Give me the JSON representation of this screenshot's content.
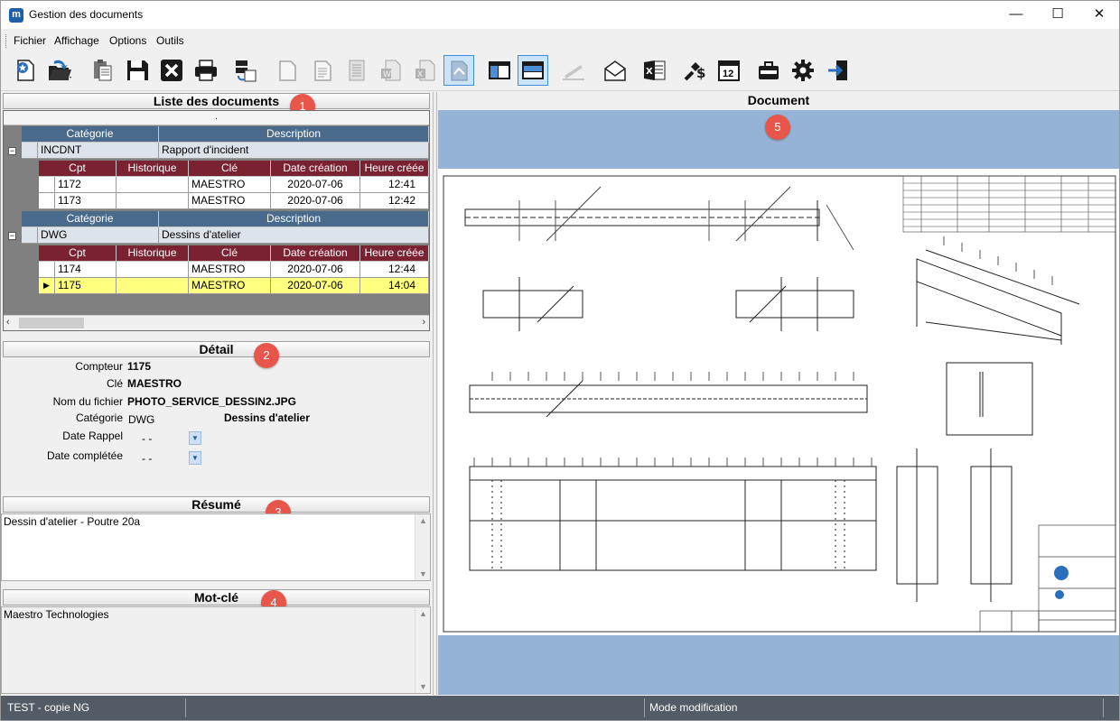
{
  "window": {
    "title": "Gestion des documents",
    "app_icon_letter": "m",
    "controls": {
      "minimize": "—",
      "maximize": "☐",
      "close": "✕"
    }
  },
  "menu": [
    "Fichier",
    "Affichage",
    "Options",
    "Outils"
  ],
  "toolbar": {
    "icons": [
      "new-document-icon",
      "open-folder-icon",
      "paste-icon",
      "save-icon",
      "cancel-icon",
      "print-icon",
      "scan-icon",
      "blank-page-icon",
      "text-page-icon",
      "lined-page-icon",
      "word-doc-icon",
      "excel-doc-icon",
      "image-tool-icon",
      "layout-view-icon",
      "layout-view-alt-icon",
      "pen-icon",
      "email-icon",
      "excel-export-icon",
      "price-icon",
      "calendar-icon",
      "briefcase-icon",
      "settings-icon",
      "exit-icon"
    ],
    "calendar_day": "12"
  },
  "list_panel": {
    "title": "Liste des documents",
    "badge": "1",
    "top_strip": ".",
    "group_headers": {
      "category": "Catégorie",
      "description": "Description"
    },
    "columns": [
      "Cpt",
      "Historique",
      "Clé",
      "Date création",
      "Heure créée"
    ],
    "groups": [
      {
        "category": "INCDNT",
        "description": "Rapport d'incident",
        "rows": [
          {
            "cpt": "1172",
            "historique": "",
            "cle": "MAESTRO",
            "date": "2020-07-06",
            "heure": "12:41"
          },
          {
            "cpt": "1173",
            "historique": "",
            "cle": "MAESTRO",
            "date": "2020-07-06",
            "heure": "12:42"
          }
        ]
      },
      {
        "category": "DWG",
        "description": "Dessins d'atelier",
        "rows": [
          {
            "cpt": "1174",
            "historique": "",
            "cle": "MAESTRO",
            "date": "2020-07-06",
            "heure": "12:44"
          },
          {
            "cpt": "1175",
            "historique": "",
            "cle": "MAESTRO",
            "date": "2020-07-06",
            "heure": "14:04"
          }
        ]
      }
    ]
  },
  "detail_panel": {
    "title": "Détail",
    "badge": "2",
    "compteur_label": "Compteur",
    "compteur": "1175",
    "cle_label": "Clé",
    "cle": "MAESTRO",
    "fichier_label": "Nom du fichier",
    "fichier": "PHOTO_SERVICE_DESSIN2.JPG",
    "categorie_label": "Catégorie",
    "categorie_code": "DWG",
    "categorie_desc": "Dessins d'atelier",
    "date_rappel_label": "Date Rappel",
    "date_rappel": "- -",
    "date_completee_label": "Date complétée",
    "date_completee": "- -"
  },
  "resume_panel": {
    "title": "Résumé",
    "badge": "3",
    "text": "Dessin d'atelier - Poutre 20a"
  },
  "motcle_panel": {
    "title": "Mot-clé",
    "badge": "4",
    "text": "Maestro Technologies"
  },
  "document_panel": {
    "title": "Document",
    "badge": "5"
  },
  "status": {
    "left": "TEST - copie NG",
    "mode": "Mode modification"
  }
}
